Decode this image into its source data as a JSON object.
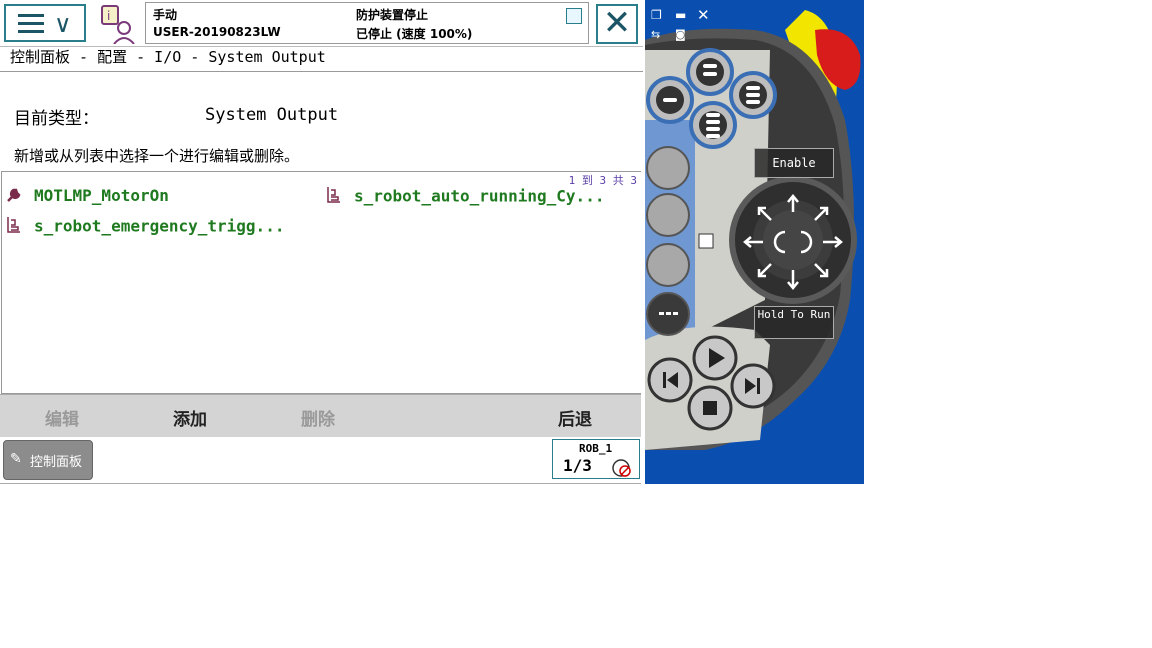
{
  "topbar": {
    "mode": "手动",
    "controller": "USER-20190823LW",
    "status": "防护装置停止",
    "speed": "已停止 (速度 100%)"
  },
  "breadcrumb": "控制面板 - 配置 - I/O - System Output",
  "current_type": {
    "label": "目前类型：",
    "value": "System Output"
  },
  "instruction": "新增或从列表中选择一个进行编辑或删除。",
  "list": {
    "count": "1 到 3 共 3",
    "items": [
      {
        "label": "MOTLMP_MotorOn",
        "icon": "wrench-icon"
      },
      {
        "label": "s_robot_auto_running_Cy...",
        "icon": "signal-icon"
      },
      {
        "label": "s_robot_emergency_trigg...",
        "icon": "signal-icon"
      }
    ]
  },
  "commands": {
    "edit": "编辑",
    "add": "添加",
    "delete": "删除",
    "back": "后退"
  },
  "taskbar": {
    "control_panel": "控制面板",
    "robot": "ROB_1",
    "fraction": "1/3"
  },
  "pendant": {
    "enable": "Enable",
    "hold_to_run": "Hold To Run"
  },
  "colors": {
    "accent": "#2a7d8a",
    "list_text": "#1f7a1f",
    "pendant_bg": "#0a4fb0",
    "pendant_yellow": "#f2e600",
    "pendant_red": "#d81b1b"
  }
}
